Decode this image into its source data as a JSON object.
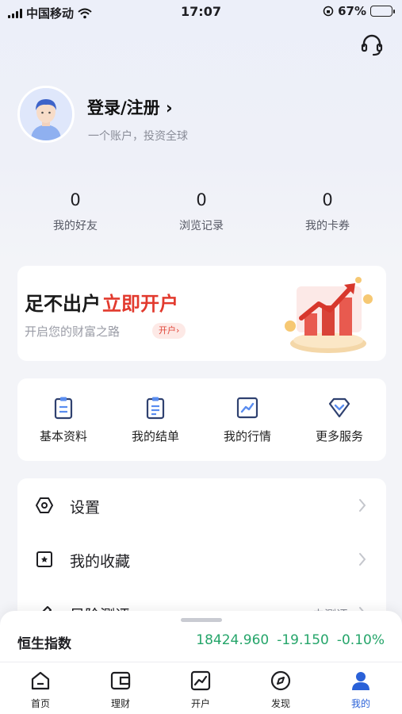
{
  "status_bar": {
    "carrier": "中国移动",
    "time": "17:07",
    "battery": "67%",
    "battery_level": 0.67
  },
  "header": {
    "support_icon": "headset-icon"
  },
  "profile": {
    "login_title": "登录/注册 ›",
    "subtitle": "一个账户，投资全球"
  },
  "stats": [
    {
      "value": "0",
      "label": "我的好友"
    },
    {
      "value": "0",
      "label": "浏览记录"
    },
    {
      "value": "0",
      "label": "我的卡券"
    }
  ],
  "promo": {
    "title_a": "足不出户",
    "title_b": "立即开户",
    "subtitle": "开启您的财富之路",
    "tag": "开户›"
  },
  "quick_actions": [
    {
      "label": "基本资料",
      "icon": "clipboard-icon"
    },
    {
      "label": "我的结单",
      "icon": "document-icon"
    },
    {
      "label": "我的行情",
      "icon": "chart-icon"
    },
    {
      "label": "更多服务",
      "icon": "diamond-icon"
    }
  ],
  "menu": [
    {
      "label": "设置",
      "icon": "settings-icon",
      "right": ""
    },
    {
      "label": "我的收藏",
      "icon": "favorites-icon",
      "right": ""
    },
    {
      "label": "风险测评",
      "icon": "pen-icon",
      "right": "去测评"
    }
  ],
  "market": {
    "name": "恒生指数",
    "price": "18424.960",
    "change": "-19.150",
    "change_pct": "-0.10%"
  },
  "tabs": [
    {
      "label": "首页",
      "icon": "home-icon"
    },
    {
      "label": "理财",
      "icon": "wallet-icon"
    },
    {
      "label": "开户",
      "icon": "chart-icon"
    },
    {
      "label": "发现",
      "icon": "compass-icon"
    },
    {
      "label": "我的",
      "icon": "user-icon"
    }
  ],
  "colors": {
    "accent_red": "#e23a2e",
    "accent_blue": "#2a61d8",
    "market_green": "#25a56a"
  }
}
